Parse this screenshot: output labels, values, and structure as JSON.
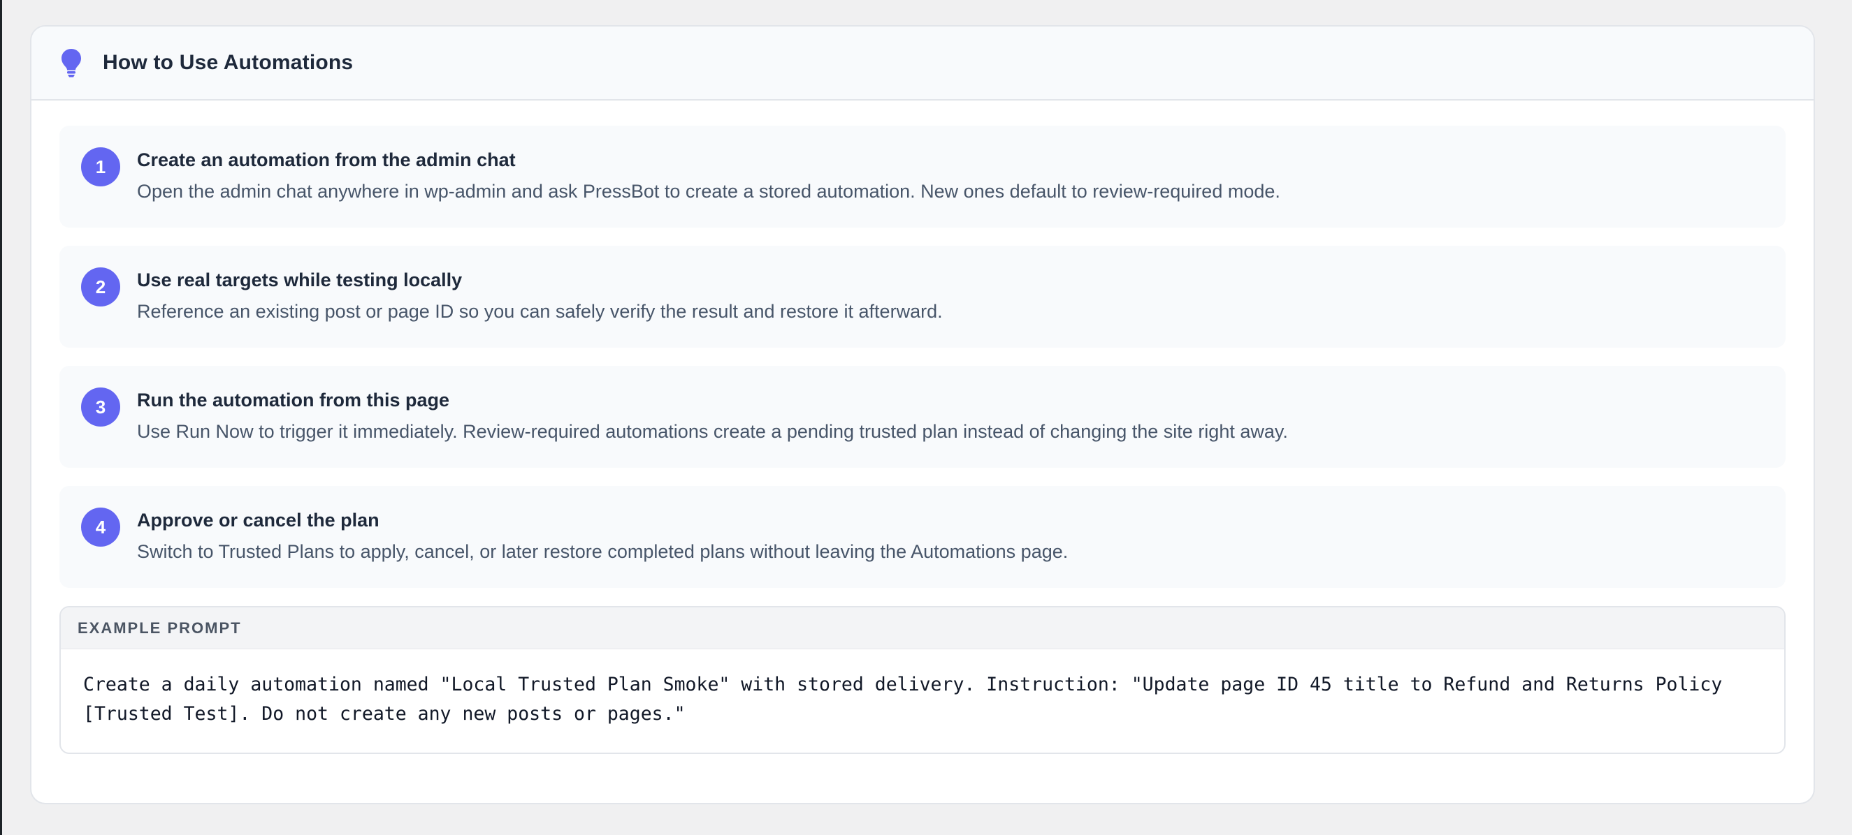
{
  "panel": {
    "title": "How to Use Automations",
    "icon": "lightbulb-icon",
    "accent_color": "#6366f1"
  },
  "steps": [
    {
      "number": "1",
      "title": "Create an automation from the admin chat",
      "description": "Open the admin chat anywhere in wp-admin and ask PressBot to create a stored automation. New ones default to review-required mode."
    },
    {
      "number": "2",
      "title": "Use real targets while testing locally",
      "description": "Reference an existing post or page ID so you can safely verify the result and restore it afterward."
    },
    {
      "number": "3",
      "title": "Run the automation from this page",
      "description": "Use Run Now to trigger it immediately. Review-required automations create a pending trusted plan instead of changing the site right away."
    },
    {
      "number": "4",
      "title": "Approve or cancel the plan",
      "description": "Switch to Trusted Plans to apply, cancel, or later restore completed plans without leaving the Automations page."
    }
  ],
  "example": {
    "label": "EXAMPLE PROMPT",
    "prompt_line1": "Create a daily automation named \"Local Trusted Plan Smoke\" with stored delivery. Instruction: \"Update page ID 45 title to Refund and Returns Policy",
    "prompt_line2": "[Trusted Test]. Do not create any new posts or pages.\""
  }
}
